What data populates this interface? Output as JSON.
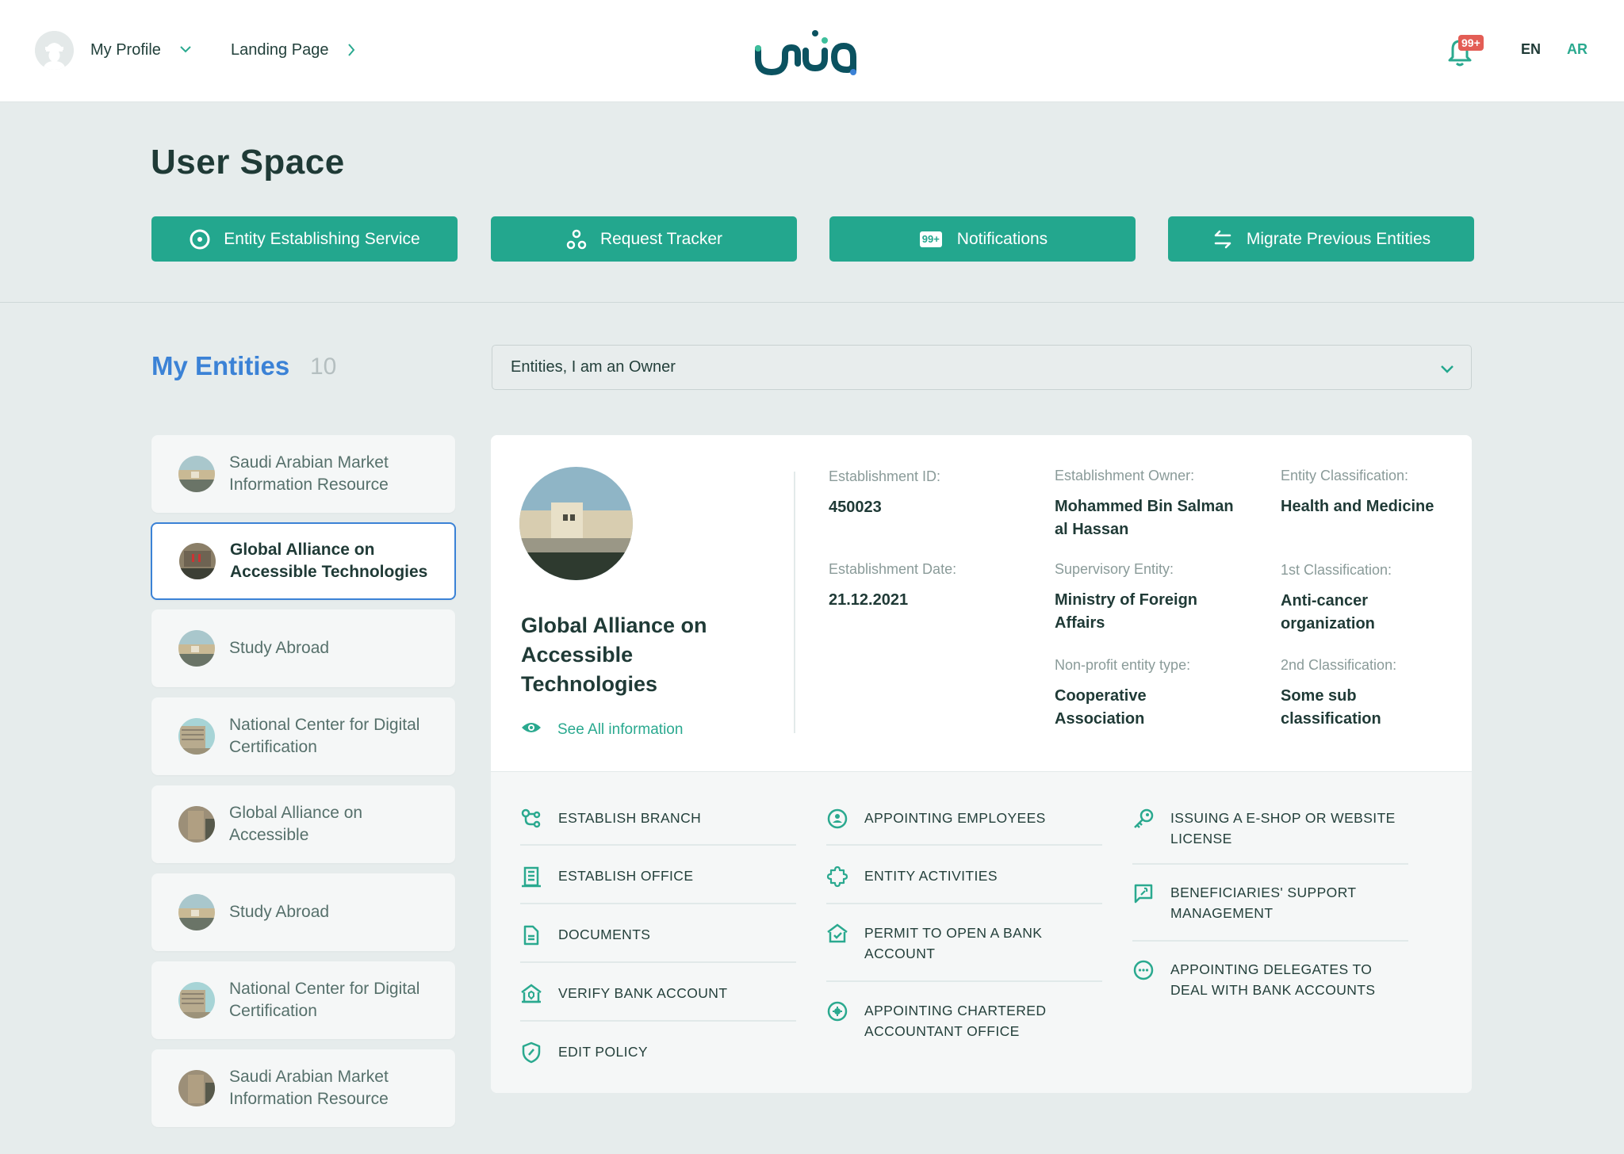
{
  "header": {
    "profile_label": "My Profile",
    "landing_label": "Landing Page",
    "logo_text": "unuq",
    "notification_badge": "99+",
    "lang_en": "EN",
    "lang_ar": "AR",
    "active_language": "AR"
  },
  "hero": {
    "title": "User Space",
    "buttons": [
      {
        "label": "Entity Establishing Service",
        "icon": "target-icon"
      },
      {
        "label": "Request Tracker",
        "icon": "nodes-icon"
      },
      {
        "label": "Notifications",
        "icon": "badge-99-icon",
        "icon_text": "99+"
      },
      {
        "label": "Migrate Previous Entities",
        "icon": "swap-arrows-icon"
      }
    ]
  },
  "entities": {
    "title": "My Entities",
    "count": "10",
    "filter_value": "Entities, I am an Owner",
    "list": [
      {
        "name": "Saudi Arabian Market Information Resource",
        "active": false
      },
      {
        "name": "Global Alliance on Accessible Technologies",
        "active": true
      },
      {
        "name": "Study Abroad",
        "active": false
      },
      {
        "name": "National Center for Digital Certification",
        "active": false
      },
      {
        "name": "Global Alliance on Accessible",
        "active": false
      },
      {
        "name": "Study Abroad",
        "active": false
      },
      {
        "name": "National Center for Digital Certification",
        "active": false
      },
      {
        "name": "Saudi Arabian Market Information Resource",
        "active": false
      }
    ]
  },
  "detail": {
    "title": "Global Alliance on Accessible Technologies",
    "see_all_label": "See All information",
    "fields": {
      "establishment_id": {
        "label": "Establishment ID:",
        "value": "450023"
      },
      "establishment_date": {
        "label": "Establishment Date:",
        "value": "21.12.2021"
      },
      "establishment_owner": {
        "label": "Establishment Owner:",
        "value": "Mohammed Bin Salman al Hassan"
      },
      "supervisory_entity": {
        "label": "Supervisory Entity:",
        "value": "Ministry of Foreign Affairs"
      },
      "nonprofit_type": {
        "label": "Non-profit entity type:",
        "value": "Cooperative Association"
      },
      "entity_classification": {
        "label": "Entity Classification:",
        "value": "Health and Medicine"
      },
      "first_classification": {
        "label": "1st Classification:",
        "value": "Anti-cancer organization"
      },
      "second_classification": {
        "label": "2nd Classification:",
        "value": "Some sub classification"
      }
    },
    "actions": {
      "col1": [
        {
          "label": "ESTABLISH BRANCH",
          "icon": "branch-icon"
        },
        {
          "label": "ESTABLISH OFFICE",
          "icon": "building-icon"
        },
        {
          "label": "DOCUMENTS",
          "icon": "document-icon"
        },
        {
          "label": "VERIFY BANK ACCOUNT",
          "icon": "bank-shield-icon"
        },
        {
          "label": "EDIT POLICY",
          "icon": "shield-edit-icon"
        }
      ],
      "col2": [
        {
          "label": "APPOINTING EMPLOYEES",
          "icon": "user-circle-icon"
        },
        {
          "label": "ENTITY ACTIVITIES",
          "icon": "puzzle-icon"
        },
        {
          "label": "PERMIT TO OPEN A BANK ACCOUNT",
          "icon": "bank-check-icon"
        },
        {
          "label": "APPOINTING CHARTERED ACCOUNTANT OFFICE",
          "icon": "gear-circle-icon"
        }
      ],
      "col3": [
        {
          "label": "ISSUING A E-SHOP OR WEBSITE LICENSE",
          "icon": "key-icon"
        },
        {
          "label": "BENEFICIARIES' SUPPORT MANAGEMENT",
          "icon": "chat-wrench-icon"
        },
        {
          "label": "APPOINTING DELEGATES TO DEAL WITH BANK ACCOUNTS",
          "icon": "more-circle-icon"
        }
      ]
    }
  },
  "colors": {
    "accent": "#23a78e",
    "link": "#3b82d6",
    "badge": "#e35d55",
    "logo": "#0b5260"
  }
}
